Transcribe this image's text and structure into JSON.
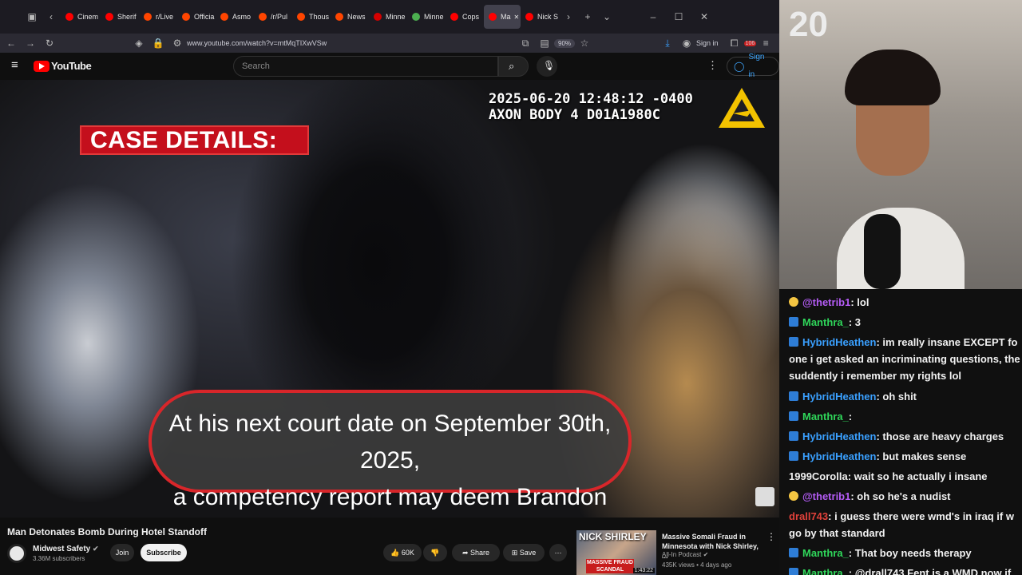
{
  "browser": {
    "tabs": [
      {
        "label": "Cinem",
        "color": "#ff0000"
      },
      {
        "label": "Sherif",
        "color": "#ff0000"
      },
      {
        "label": "r/Live",
        "color": "#ff4500"
      },
      {
        "label": "Officia",
        "color": "#ff4500"
      },
      {
        "label": "Asmo",
        "color": "#ff4500"
      },
      {
        "label": "/r/Pul",
        "color": "#ff4500"
      },
      {
        "label": "Thous",
        "color": "#ff4500"
      },
      {
        "label": "News",
        "color": "#ff4500"
      },
      {
        "label": "Minne",
        "color": "#d40000"
      },
      {
        "label": "Minne",
        "color": "#4caf50"
      },
      {
        "label": "Cops",
        "color": "#ff0000"
      },
      {
        "label": "Ma",
        "color": "#ff0000"
      },
      {
        "label": "Nick S",
        "color": "#ff0000"
      }
    ],
    "url": "www.youtube.com/watch?v=mtMqTIXwVSw",
    "zoom": "90%",
    "signin": "Sign in",
    "badge_count": "106"
  },
  "youtube": {
    "logo": "YouTube",
    "search_placeholder": "Search",
    "signin": "Sign in"
  },
  "video": {
    "overlay_title": "CASE DETAILS:",
    "timestamp_line1": "2025-06-20 12:48:12 -0400",
    "timestamp_line2": "AXON BODY 4 D01A1980C",
    "caption_line1": "At his next court date on September 30th, 2025,",
    "caption_line2": "a competency report may deem Brandon",
    "title": "Man Detonates Bomb During Hotel Standoff",
    "channel": "Midwest Safety",
    "subscribers": "3.36M subscribers",
    "join": "Join",
    "subscribe": "Subscribe",
    "likes": "60K",
    "share": "Share",
    "save": "Save"
  },
  "recommended": {
    "thumb_label": "NICK SHIRLEY",
    "thumb_tag": "MASSIVE FRAUD SCANDAL",
    "duration": "1:43:22",
    "title": "Massive Somali Fraud in Minnesota with Nick Shirley, ...",
    "channel": "All-In Podcast",
    "meta": "435K views • 4 days ago"
  },
  "stream": {
    "corner_text": "20"
  },
  "chat": [
    {
      "user": "@thetrib1",
      "color": "#b45cf5",
      "badge": "star",
      "text": ": lol"
    },
    {
      "user": "Manthra_",
      "color": "#2fd65a",
      "badge": "sub",
      "text": ": 3"
    },
    {
      "user": "HybridHeathen",
      "color": "#3aa0ff",
      "badge": "sub",
      "text": ": im really insane EXCEPT fo"
    },
    {
      "user": "",
      "color": "#f1f1f1",
      "badge": "",
      "text": "one i get asked an incriminating questions, the"
    },
    {
      "user": "",
      "color": "#f1f1f1",
      "badge": "",
      "text": "suddently i remember my rights lol"
    },
    {
      "user": "HybridHeathen",
      "color": "#3aa0ff",
      "badge": "sub",
      "text": ": oh shit"
    },
    {
      "user": "Manthra_",
      "color": "#2fd65a",
      "badge": "sub",
      "text": ":"
    },
    {
      "user": "HybridHeathen",
      "color": "#3aa0ff",
      "badge": "sub",
      "text": ": those are heavy charges"
    },
    {
      "user": "HybridHeathen",
      "color": "#3aa0ff",
      "badge": "sub",
      "text": ": but makes sense"
    },
    {
      "user": "1999Corolla",
      "color": "#f1f1f1",
      "badge": "",
      "text": ": wait so he actually i insane"
    },
    {
      "user": "@thetrib1",
      "color": "#b45cf5",
      "badge": "star",
      "text": ": oh so he's a nudist"
    },
    {
      "user": "drall743",
      "color": "#e0413a",
      "badge": "",
      "text": ": i guess there were wmd's in iraq if w"
    },
    {
      "user": "",
      "color": "#f1f1f1",
      "badge": "",
      "text": "go by that standard"
    },
    {
      "user": "Manthra_",
      "color": "#2fd65a",
      "badge": "sub",
      "text": ": That boy needs therapy"
    },
    {
      "user": "Manthra_",
      "color": "#2fd65a",
      "badge": "sub",
      "text": ": @drall743 Fent is a WMD now if"
    }
  ]
}
